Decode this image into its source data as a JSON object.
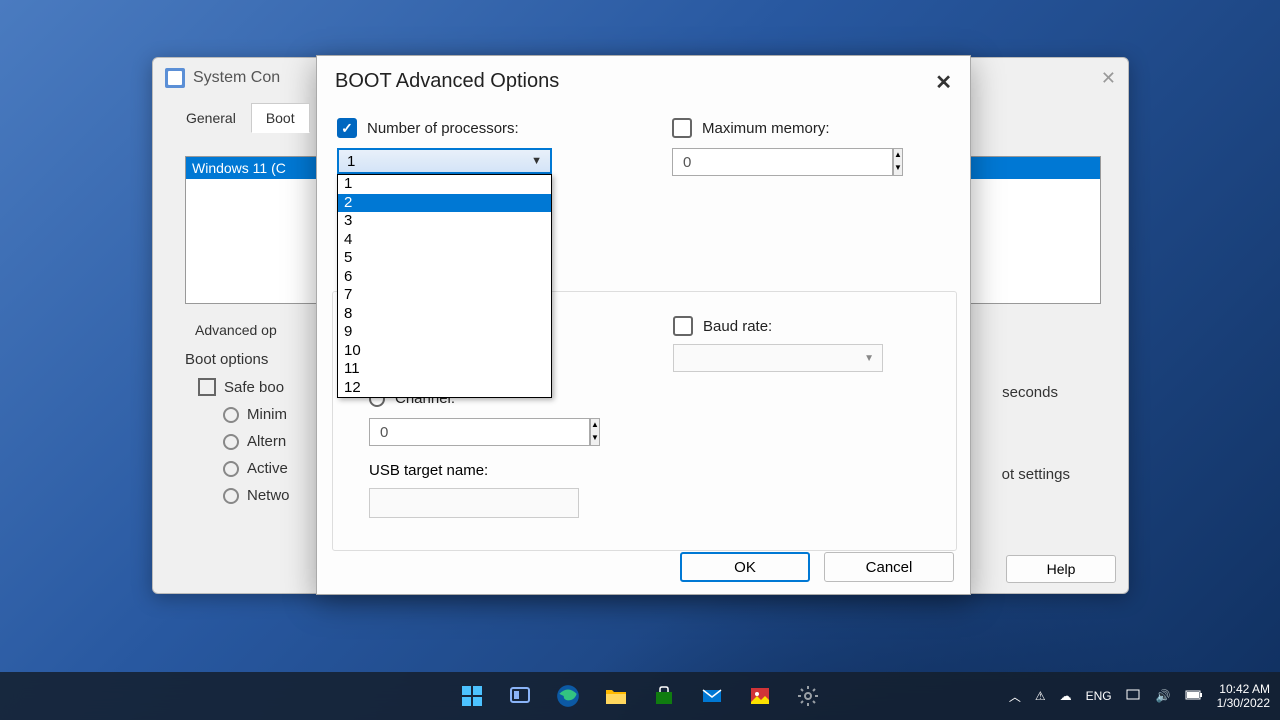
{
  "parent_window": {
    "title": "System Con",
    "tabs": [
      "General",
      "Boot"
    ],
    "active_tab": 1,
    "list_selected": "Windows 11 (C",
    "adv_button": "Advanced op",
    "boot_group_label": "Boot options",
    "safe_boot": "Safe boo",
    "radios": [
      "Minim",
      "Altern",
      "Active",
      "Netwo"
    ],
    "seconds": "seconds",
    "settings_frag": "ot settings",
    "help": "Help"
  },
  "dialog": {
    "title": "BOOT Advanced Options",
    "num_proc_label": "Number of processors:",
    "num_proc_checked": true,
    "num_proc_value": "1",
    "num_proc_options": [
      "1",
      "2",
      "3",
      "4",
      "5",
      "6",
      "7",
      "8",
      "9",
      "10",
      "11",
      "12"
    ],
    "num_proc_highlight": "2",
    "max_mem_label": "Maximum memory:",
    "max_mem_checked": false,
    "max_mem_value": "0",
    "baud_label": "Baud rate:",
    "baud_checked": false,
    "channel_label": "Channel:",
    "channel_value": "0",
    "usb_label": "USB target name:",
    "ok": "OK",
    "cancel": "Cancel"
  },
  "taskbar": {
    "lang": "ENG",
    "time": "10:42 AM",
    "date": "1/30/2022"
  }
}
